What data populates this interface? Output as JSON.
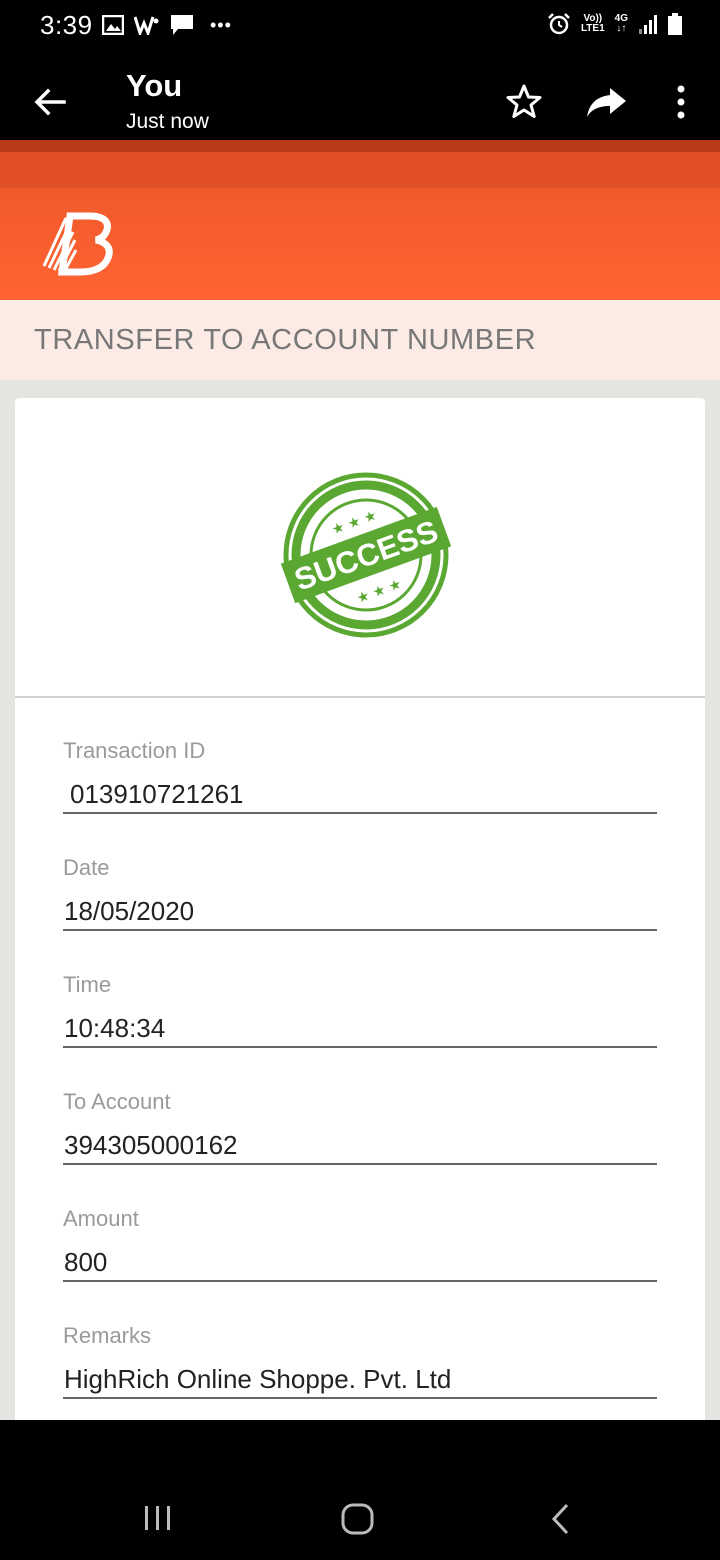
{
  "status_bar": {
    "time": "3:39",
    "more_indicator": "•••",
    "volte_top": "Vo))",
    "volte_bottom": "LTE1",
    "network_type": "4G",
    "icons": [
      "image-icon",
      "w-app-icon",
      "message-icon",
      "alarm-icon",
      "signal-icon",
      "battery-icon"
    ]
  },
  "app_bar": {
    "title": "You",
    "subtitle": "Just now",
    "icons": [
      "back-arrow-icon",
      "star-icon",
      "share-icon",
      "more-vert-icon"
    ]
  },
  "brand": {
    "colors": {
      "header": "#ff6333",
      "stripe_dark": "#b83a18",
      "stripe_mid": "#e04f26",
      "heading_bg": "#fceae5",
      "stamp_green": "#5aa832"
    }
  },
  "page": {
    "heading": "TRANSFER TO ACCOUNT NUMBER",
    "stamp_text": "SUCCESS"
  },
  "fields": [
    {
      "label": "Transaction ID",
      "value": "013910721261"
    },
    {
      "label": "Date",
      "value": "18/05/2020"
    },
    {
      "label": "Time",
      "value": "10:48:34"
    },
    {
      "label": "To Account",
      "value": "394305000162"
    },
    {
      "label": "Amount",
      "value": "800"
    },
    {
      "label": "Remarks",
      "value": "HighRich Online Shoppe. Pvt. Ltd"
    }
  ],
  "nav_bar": {
    "icons": [
      "recent-apps-icon",
      "home-icon",
      "back-icon"
    ]
  }
}
